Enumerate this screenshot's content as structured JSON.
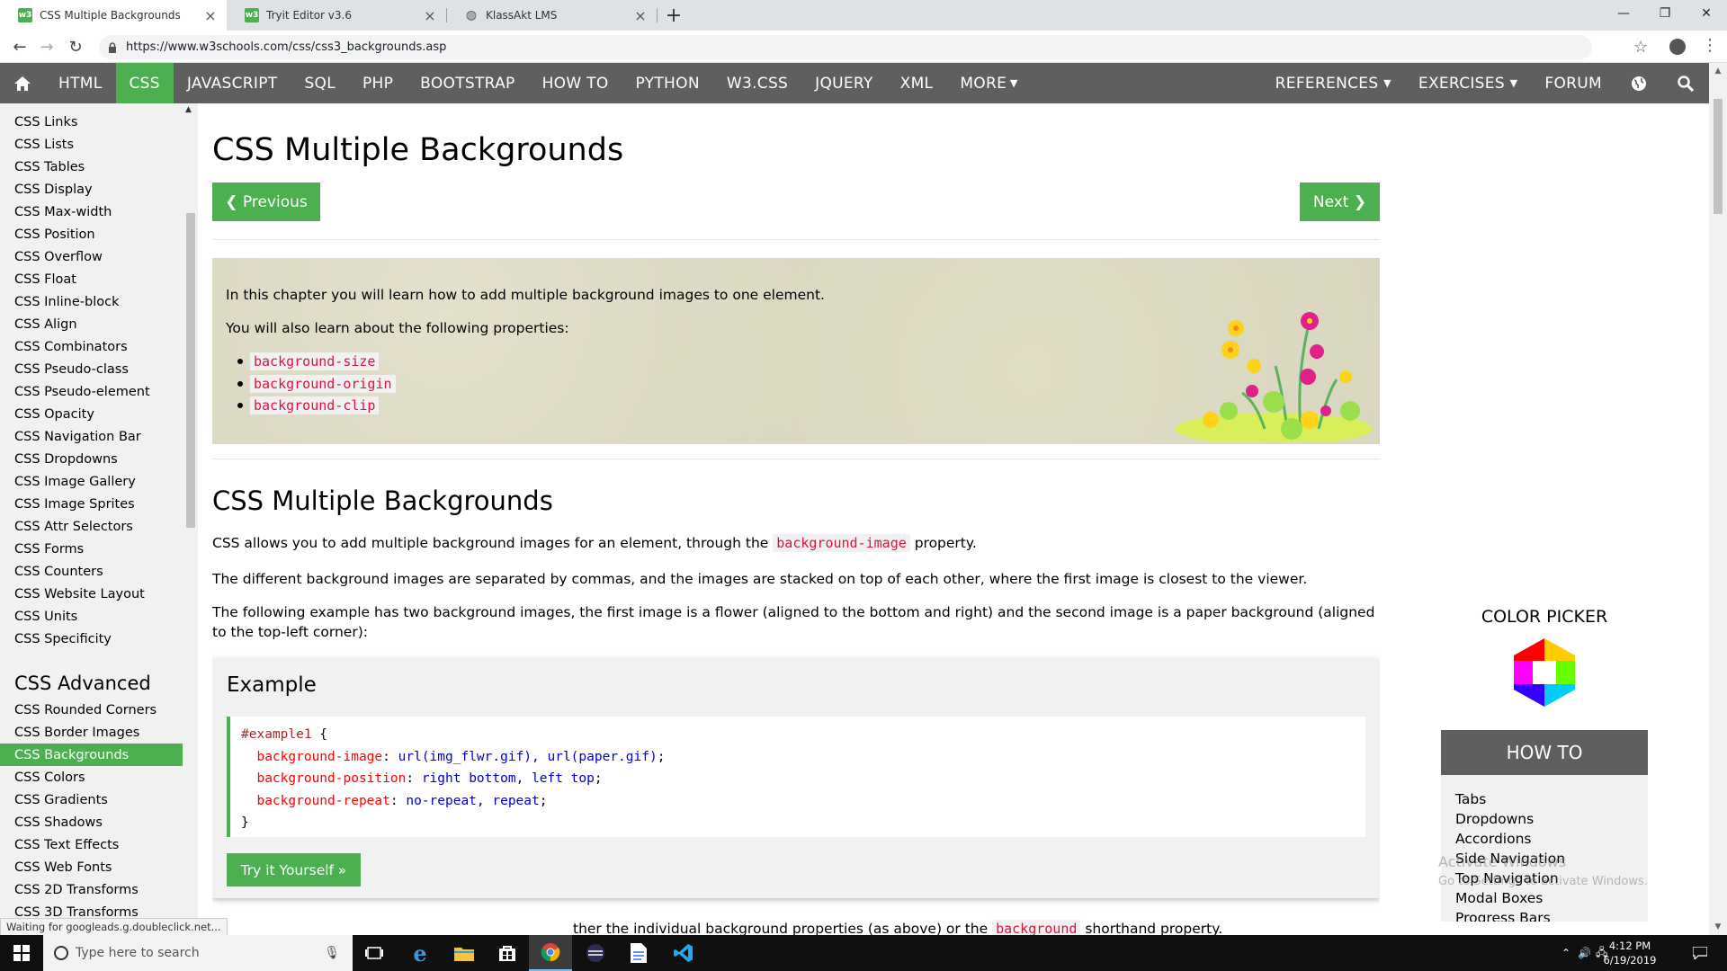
{
  "browser": {
    "tabs": [
      {
        "title": "CSS Multiple Backgrounds",
        "favicon": "w3schools-icon",
        "active": true
      },
      {
        "title": "Tryit Editor v3.6",
        "favicon": "w3schools-icon",
        "active": false
      },
      {
        "title": "KlassAkt LMS",
        "favicon": "globe-icon",
        "active": false
      }
    ],
    "url": "https://www.w3schools.com/css/css3_backgrounds.asp",
    "status_text": "Waiting for googleads.g.doubleclick.net..."
  },
  "topnav": {
    "items": [
      "HTML",
      "CSS",
      "JAVASCRIPT",
      "SQL",
      "PHP",
      "BOOTSTRAP",
      "HOW TO",
      "PYTHON",
      "W3.CSS",
      "JQUERY",
      "XML",
      "MORE"
    ],
    "active": "CSS",
    "right_items": [
      "REFERENCES",
      "EXERCISES",
      "FORUM"
    ]
  },
  "sidebar": {
    "links": [
      "CSS Links",
      "CSS Lists",
      "CSS Tables",
      "CSS Display",
      "CSS Max-width",
      "CSS Position",
      "CSS Overflow",
      "CSS Float",
      "CSS Inline-block",
      "CSS Align",
      "CSS Combinators",
      "CSS Pseudo-class",
      "CSS Pseudo-element",
      "CSS Opacity",
      "CSS Navigation Bar",
      "CSS Dropdowns",
      "CSS Image Gallery",
      "CSS Image Sprites",
      "CSS Attr Selectors",
      "CSS Forms",
      "CSS Counters",
      "CSS Website Layout",
      "CSS Units",
      "CSS Specificity"
    ],
    "advanced_heading": "CSS Advanced",
    "advanced_links": [
      "CSS Rounded Corners",
      "CSS Border Images",
      "CSS Backgrounds",
      "CSS Colors",
      "CSS Gradients",
      "CSS Shadows",
      "CSS Text Effects",
      "CSS Web Fonts",
      "CSS 2D Transforms",
      "CSS 3D Transforms"
    ],
    "active": "CSS Backgrounds"
  },
  "main": {
    "title": "CSS Multiple Backgrounds",
    "prev_label": "❮ Previous",
    "next_label": "Next ❯",
    "intro_p1": "In this chapter you will learn how to add multiple background images to one element.",
    "intro_p2": "You will also learn about the following properties:",
    "intro_props": [
      "background-size",
      "background-origin",
      "background-clip"
    ],
    "section_title": "CSS Multiple Backgrounds",
    "p1_before": "CSS allows you to add multiple background images for an element, through the ",
    "p1_code": "background-image",
    "p1_after": " property.",
    "p2": "The different background images are separated by commas, and the images are stacked on top of each other, where the first image is closest to the viewer.",
    "p3": "The following example has two background images, the first image is a flower (aligned to the bottom and right) and the second image is a paper background (aligned to the top-left corner):",
    "example_title": "Example",
    "code": {
      "selector": "#example1",
      "open": " {",
      "lines": [
        {
          "prop": "background-image",
          "val": "url(img_flwr.gif), url(paper.gif)"
        },
        {
          "prop": "background-position",
          "val": "right bottom, left top"
        },
        {
          "prop": "background-repeat",
          "val": "no-repeat, repeat"
        }
      ],
      "close": "}"
    },
    "try_label": "Try it Yourself »",
    "partial_before": "ther the individual background properties (as above) or the ",
    "partial_code": "background",
    "partial_after": " shorthand property."
  },
  "rightcol": {
    "color_picker_title": "COLOR PICKER",
    "howto_title": "HOW TO",
    "howto_links": [
      "Tabs",
      "Dropdowns",
      "Accordions",
      "Side Navigation",
      "Top Navigation",
      "Modal Boxes",
      "Progress Bars"
    ],
    "watermark_1": "Activate Windows",
    "watermark_2": "Go to Settings to activate Windows."
  },
  "taskbar": {
    "search_placeholder": "Type here to search",
    "time": "4:12 PM",
    "date": "6/19/2019"
  },
  "colors": {
    "w3_green": "#4caf50",
    "nav_gray": "#5f5f5f",
    "sidebar_bg": "#f1f1f1",
    "code_red": "#dc143c"
  }
}
